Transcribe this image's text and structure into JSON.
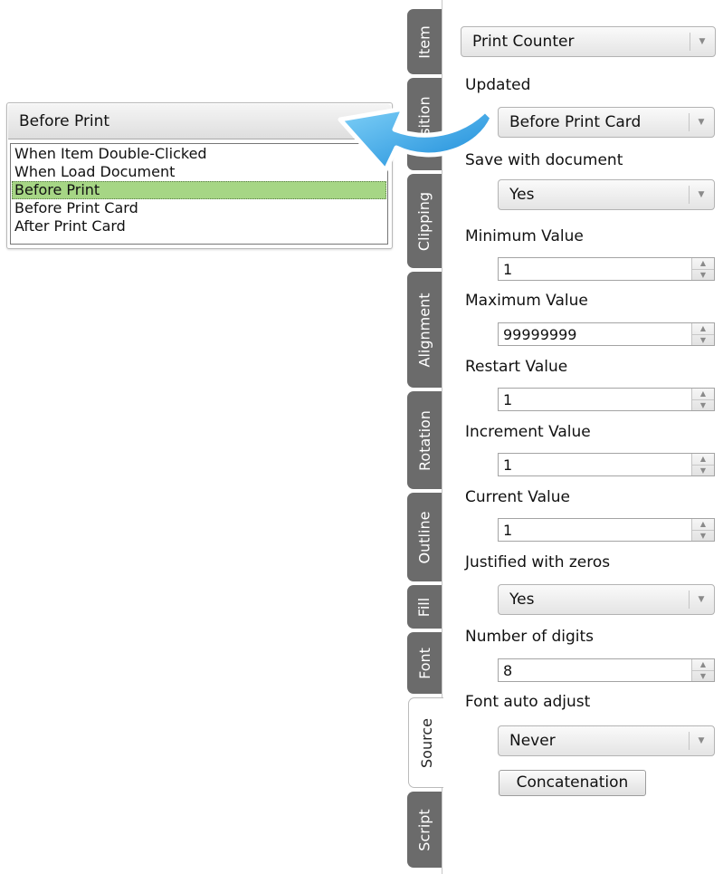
{
  "popup": {
    "selected": "Before Print",
    "options": [
      {
        "label": "When Item Double-Clicked",
        "selected": false
      },
      {
        "label": "When Load Document",
        "selected": false
      },
      {
        "label": "Before Print",
        "selected": true
      },
      {
        "label": "Before Print Card",
        "selected": false
      },
      {
        "label": "After Print Card",
        "selected": false
      }
    ]
  },
  "tabs": [
    {
      "label": "Item",
      "active": false
    },
    {
      "label": "Position",
      "active": false
    },
    {
      "label": "Clipping",
      "active": false
    },
    {
      "label": "Alignment",
      "active": false
    },
    {
      "label": "Rotation",
      "active": false
    },
    {
      "label": "Outline",
      "active": false
    },
    {
      "label": "Fill",
      "active": false
    },
    {
      "label": "Font",
      "active": false
    },
    {
      "label": "Source",
      "active": true
    },
    {
      "label": "Script",
      "active": false
    }
  ],
  "panel": {
    "source_type": "Print Counter",
    "updated_label": "Updated",
    "updated_value": "Before Print Card",
    "save_label": "Save with document",
    "save_value": "Yes",
    "min_label": "Minimum Value",
    "min_value": "1",
    "max_label": "Maximum Value",
    "max_value": "99999999",
    "restart_label": "Restart Value",
    "restart_value": "1",
    "increment_label": "Increment Value",
    "increment_value": "1",
    "current_label": "Current Value",
    "current_value": "1",
    "justified_label": "Justified with zeros",
    "justified_value": "Yes",
    "digits_label": "Number of digits",
    "digits_value": "8",
    "autoadjust_label": "Font auto adjust",
    "autoadjust_value": "Never",
    "concat_button": "Concatenation"
  },
  "icons": {
    "dropdown_arrow": "chevron-down-icon",
    "spin_up": "spin-up-icon",
    "spin_down": "spin-down-icon",
    "callout": "curved-arrow-icon"
  },
  "colors": {
    "selection": "#a6d685",
    "tab": "#6b6b6b",
    "callout_arrow": "#2aa3e6"
  }
}
